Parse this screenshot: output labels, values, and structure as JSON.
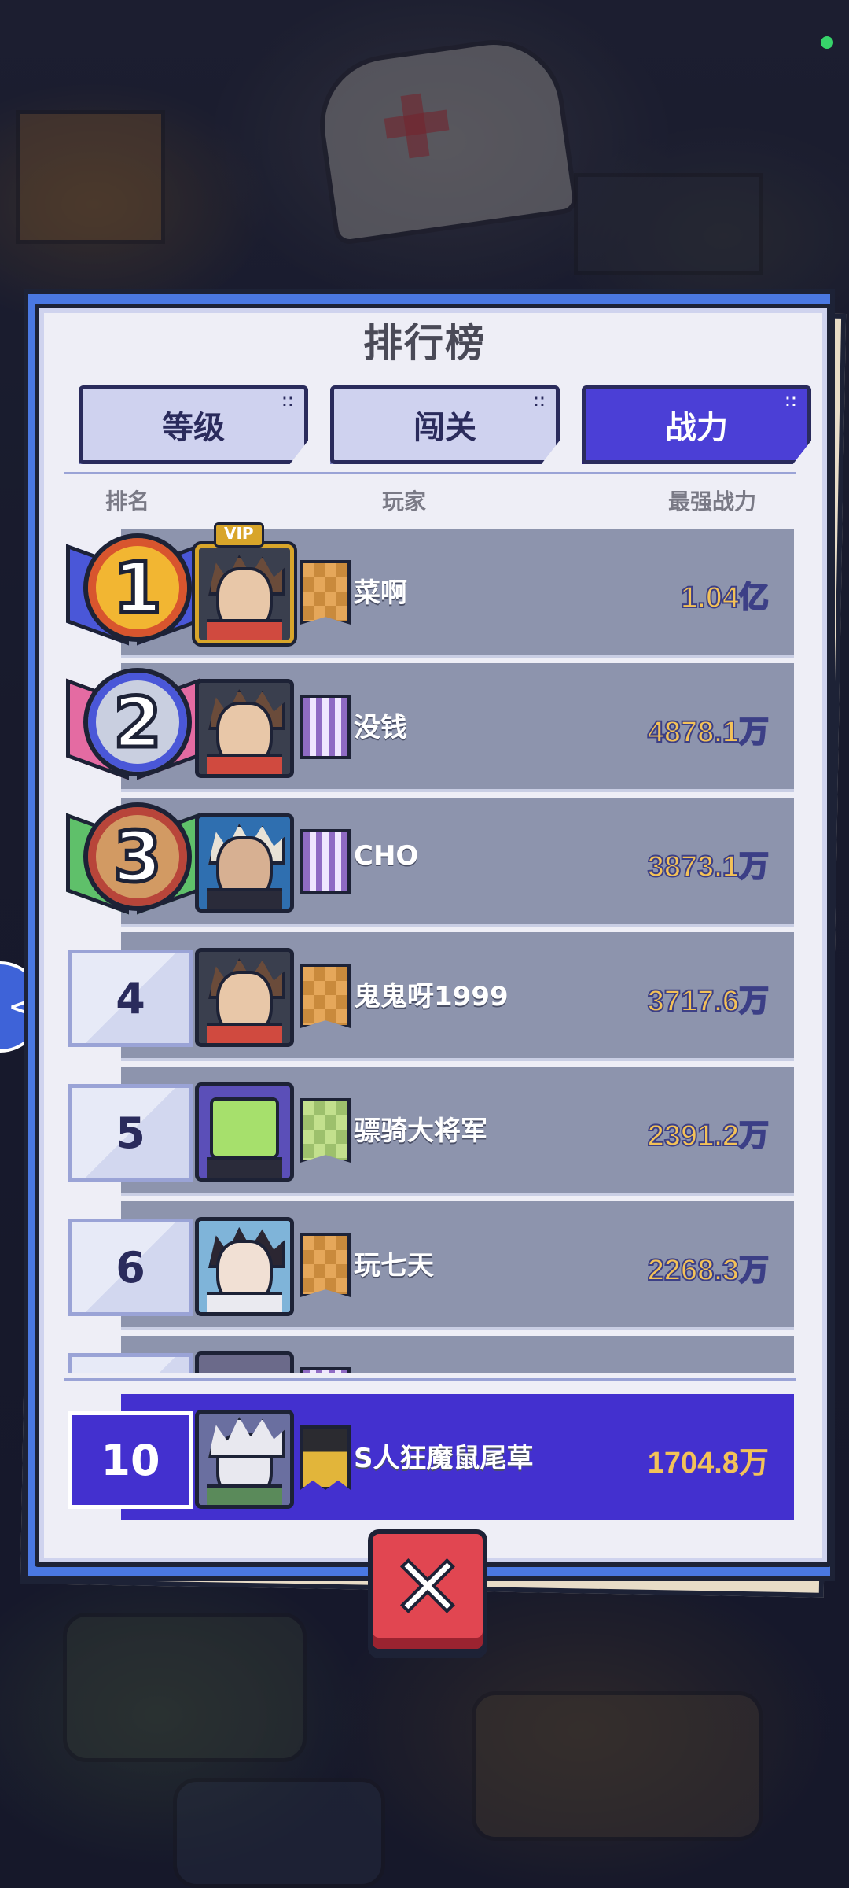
{
  "panel": {
    "title": "排行榜"
  },
  "tabs": [
    {
      "label": "等级",
      "active": false
    },
    {
      "label": "闯关",
      "active": false
    },
    {
      "label": "战力",
      "active": true
    }
  ],
  "columns": {
    "rank": "排名",
    "player": "玩家",
    "power": "最强战力"
  },
  "rows": [
    {
      "rank": "1",
      "name": "菜啊",
      "power": "1.04亿",
      "vip": true,
      "vip_label": "VIP",
      "flag": "orange"
    },
    {
      "rank": "2",
      "name": "没钱",
      "power": "4878.1万",
      "flag": "purple"
    },
    {
      "rank": "3",
      "name": "CHO",
      "power": "3873.1万",
      "flag": "purple"
    },
    {
      "rank": "4",
      "name": "鬼鬼呀1999",
      "power": "3717.6万",
      "flag": "orange"
    },
    {
      "rank": "5",
      "name": "骠骑大将军",
      "power": "2391.2万",
      "flag": "green"
    },
    {
      "rank": "6",
      "name": "玩七天",
      "power": "2268.3万",
      "flag": "orange"
    }
  ],
  "my_rank": {
    "rank": "10",
    "name": "S人狂魔鼠尾草",
    "power": "1704.8万",
    "flag": "black"
  },
  "medal_colors": {
    "gold": "#f2b632",
    "silver": "#c9cfe0",
    "bronze": "#d29a63"
  },
  "icons": {
    "close": "close-icon",
    "side_tab": "chevron-left-icon"
  }
}
